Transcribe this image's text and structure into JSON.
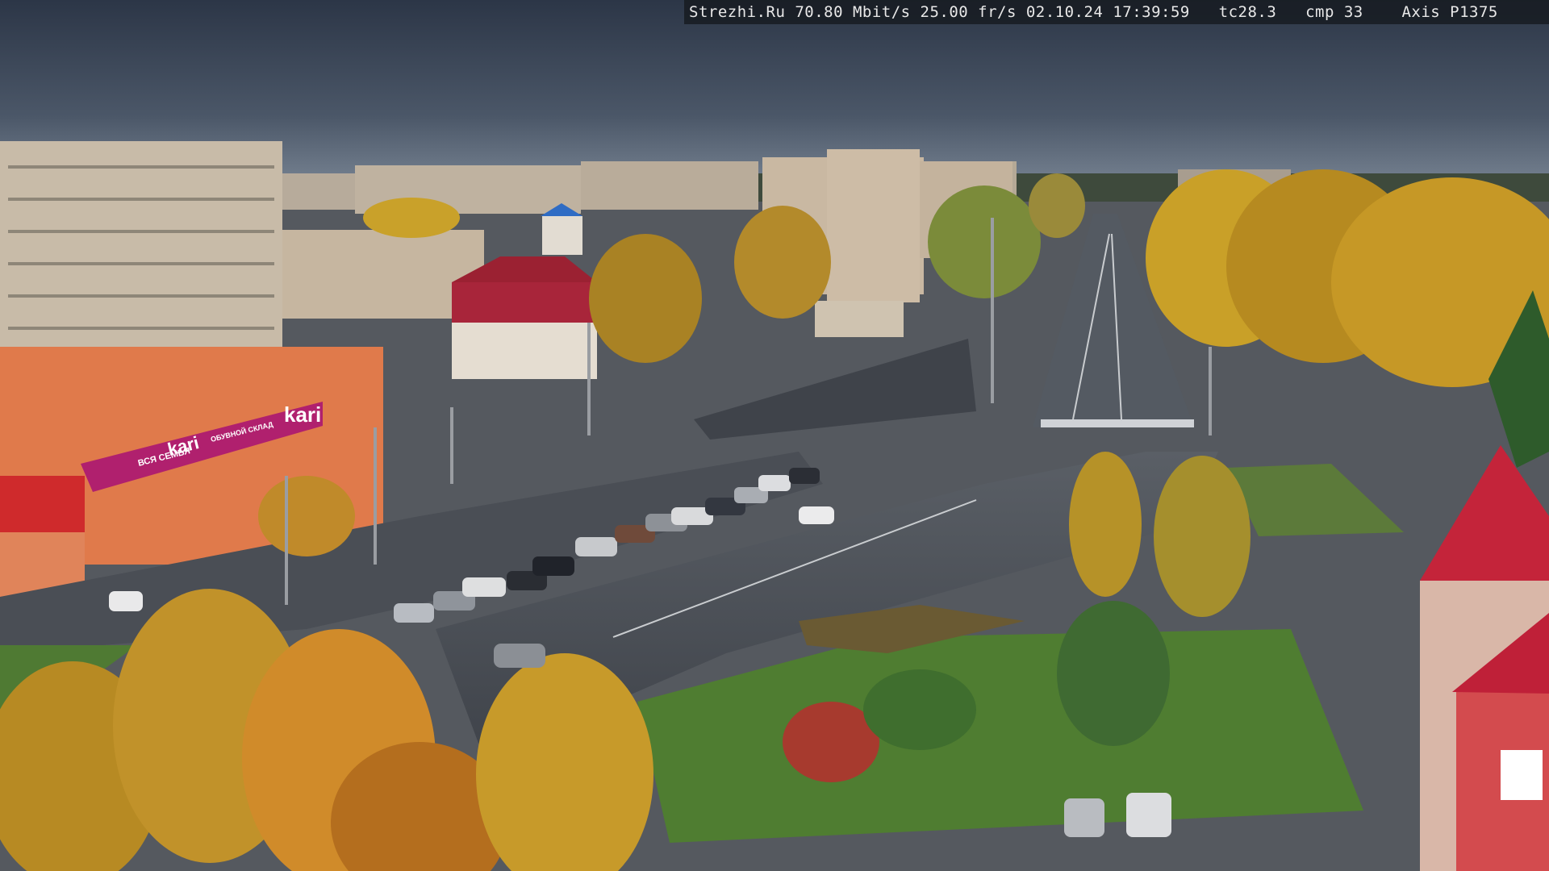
{
  "overlay": {
    "text": "Strezhi.Ru 70.80 Mbit/s 25.00 fr/s 02.10.24 17:39:59   tc28.3   cmp 33    Axis P1375"
  },
  "signs": {
    "store_brand": "kari",
    "store_brand_small": "kari",
    "store_tagline": "ВСЯ СЕМЬЯ",
    "store_tagline_2": "ОБУВНОЙ СКЛАД"
  },
  "colors": {
    "sky_top": "#2f3a4c",
    "sky_bottom": "#6f7d8e",
    "asphalt": "#4a4e55",
    "grass": "#4f7a33",
    "autumn_yellow": "#c79a22",
    "kari_magenta": "#b0206e",
    "red_roof": "#c4243a"
  }
}
